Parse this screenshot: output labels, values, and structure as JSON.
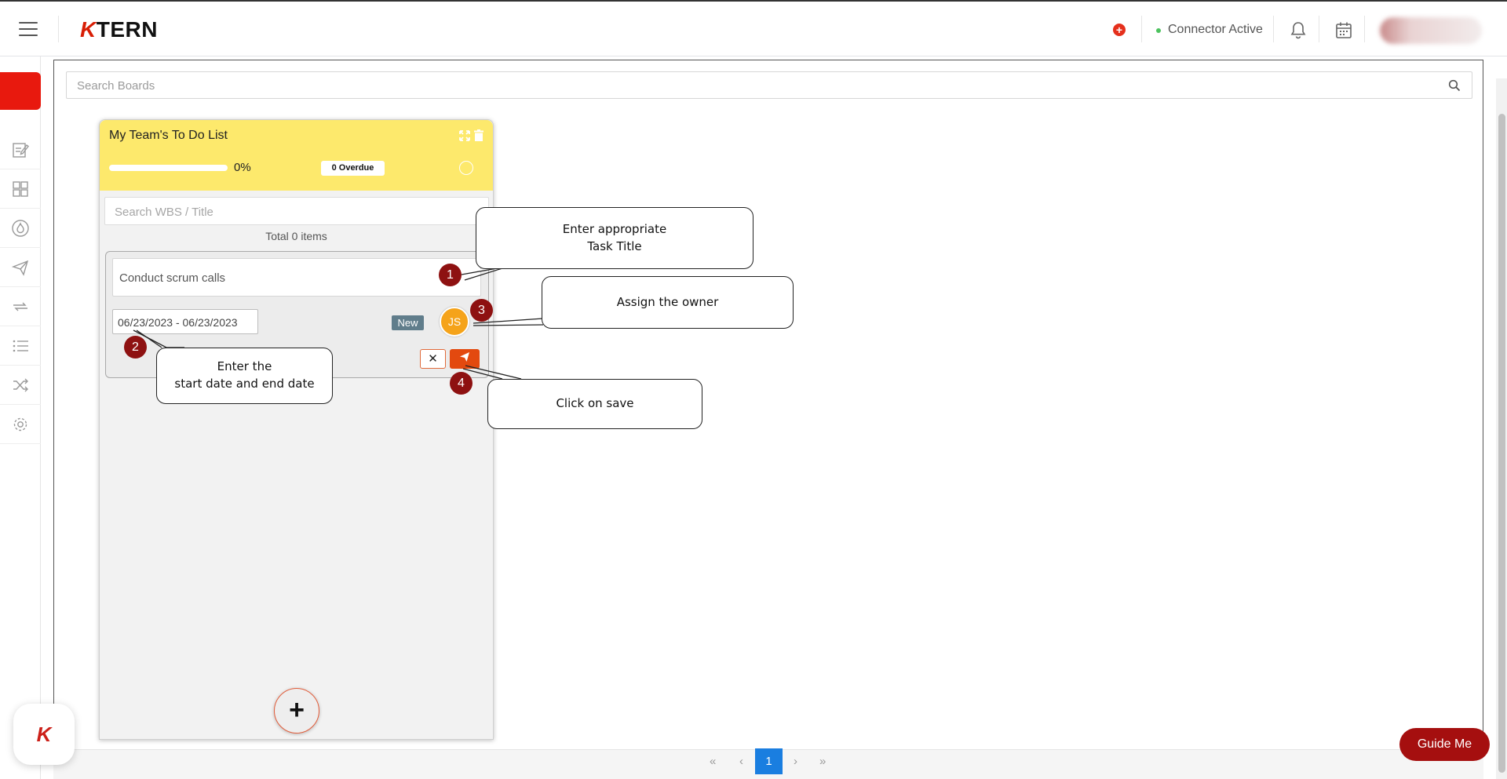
{
  "app": {
    "logo_prefix": "K",
    "logo_suffix": "TERN",
    "connector_status": "Connector Active"
  },
  "search": {
    "boards_placeholder": "Search Boards"
  },
  "board": {
    "title": "My Team's To Do List",
    "progress": 0,
    "progress_text": "0%",
    "overdue": "0 Overdue",
    "wbs_placeholder": "Search WBS / Title",
    "total_items": "Total 0 items",
    "task": {
      "title": "Conduct scrum calls",
      "date_range": "06/23/2023 - 06/23/2023",
      "status": "New",
      "owner_initials": "JS"
    },
    "add_label": "+"
  },
  "pagination": {
    "first": "«",
    "prev": "‹",
    "current": "1",
    "next": "›",
    "last": "»"
  },
  "guide_button": "Guide Me",
  "floating_logo": "K",
  "annotations": [
    {
      "number": "1",
      "text": "Enter appropriate\nTask Title"
    },
    {
      "number": "2",
      "text": "Enter the\nstart date and end date"
    },
    {
      "number": "3",
      "text": "Assign the owner"
    },
    {
      "number": "4",
      "text": "Click on save"
    }
  ],
  "colors": {
    "brand_red": "#e8190e",
    "board_header": "#fde96c",
    "save_orange": "#e3490f",
    "owner_avatar": "#f5a31a",
    "status_badge": "#607d8b",
    "page_active": "#1a7ee0",
    "guide_button": "#a50f0f",
    "connector_dot": "#4cc25e"
  }
}
